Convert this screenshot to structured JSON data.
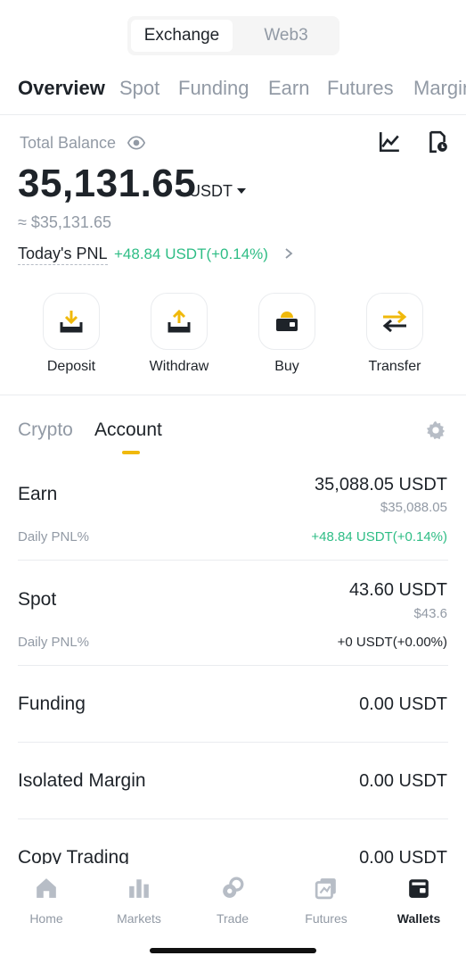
{
  "segment": {
    "exchange": "Exchange",
    "web3": "Web3"
  },
  "tabs": [
    "Overview",
    "Spot",
    "Funding",
    "Earn",
    "Futures",
    "Margin"
  ],
  "balance": {
    "label": "Total Balance",
    "amount": "35,131.65",
    "unit": "USDT",
    "approx": "≈ $35,131.65",
    "pnl_label": "Today's PNL",
    "pnl_value": "+48.84 USDT(+0.14%)"
  },
  "actions": [
    {
      "label": "Deposit",
      "icon": "deposit-icon"
    },
    {
      "label": "Withdraw",
      "icon": "withdraw-icon"
    },
    {
      "label": "Buy",
      "icon": "wallet-buy-icon"
    },
    {
      "label": "Transfer",
      "icon": "transfer-arrows-icon"
    }
  ],
  "subtabs": {
    "crypto": "Crypto",
    "account": "Account"
  },
  "accounts": [
    {
      "name": "Earn",
      "amount": "35,088.05 USDT",
      "usd": "$35,088.05",
      "pnl_label": "Daily PNL%",
      "pnl": "+48.84 USDT(+0.14%)",
      "pnl_color": "#2ebd85"
    },
    {
      "name": "Spot",
      "amount": "43.60 USDT",
      "usd": "$43.6",
      "pnl_label": "Daily PNL%",
      "pnl": "+0 USDT(+0.00%)",
      "pnl_color": "#1e2329"
    },
    {
      "name": "Funding",
      "amount": "0.00 USDT"
    },
    {
      "name": "Isolated Margin",
      "amount": "0.00 USDT"
    },
    {
      "name": "Copy Trading",
      "amount": "0.00 USDT"
    }
  ],
  "nav": [
    {
      "label": "Home",
      "icon": "home-icon"
    },
    {
      "label": "Markets",
      "icon": "bar-chart-icon"
    },
    {
      "label": "Trade",
      "icon": "trade-icon"
    },
    {
      "label": "Futures",
      "icon": "futures-icon"
    },
    {
      "label": "Wallets",
      "icon": "wallet-icon",
      "active": true
    }
  ],
  "colors": {
    "accent": "#f0b90b",
    "positive": "#2ebd85",
    "text": "#1e2329",
    "muted": "#929aa5"
  }
}
